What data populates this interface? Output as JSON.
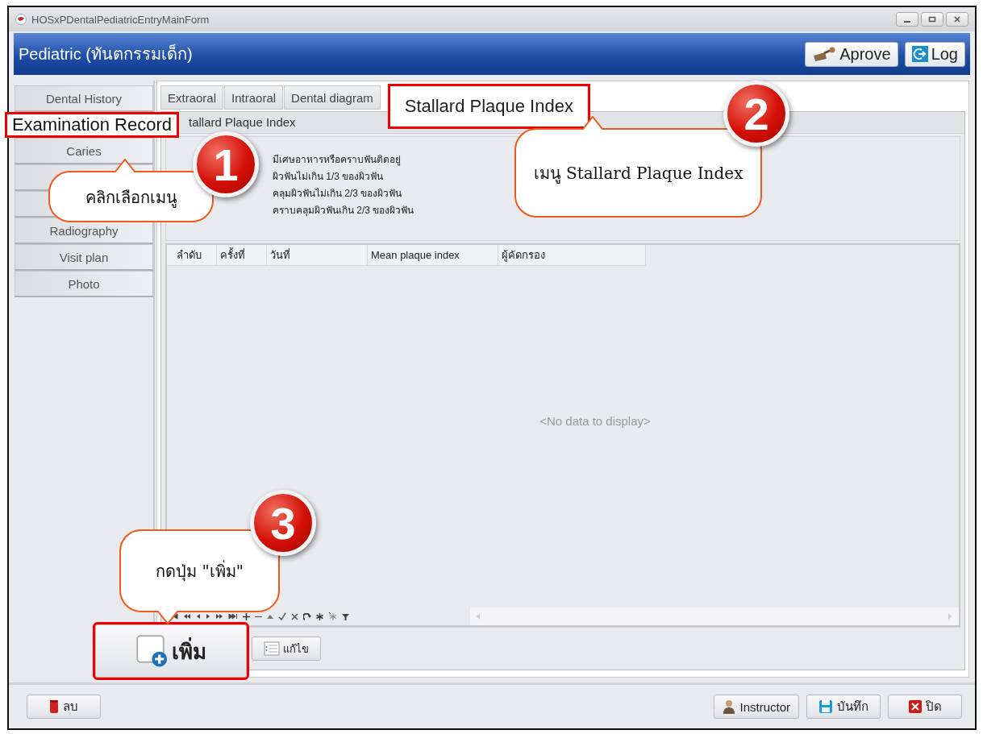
{
  "window": {
    "title": "HOSxPDentalPediatricEntryMainForm"
  },
  "header": {
    "title": "Pediatric (ทันตกรรมเด็ก)",
    "buttons": [
      {
        "label": "Aprove",
        "kind": "stamp"
      },
      {
        "label": "Log",
        "kind": "log"
      }
    ]
  },
  "sidebar": {
    "items": [
      {
        "label": "Dental History",
        "selected": false
      },
      {
        "label": "Examination Record",
        "selected": true
      },
      {
        "label": "Caries",
        "selected": false
      },
      {
        "selected": false
      },
      {
        "selected": false
      },
      {
        "label": "Radiography",
        "selected": false
      },
      {
        "label": "Visit plan",
        "selected": false
      },
      {
        "label": "Photo",
        "selected": false
      }
    ]
  },
  "tabs": [
    {
      "label": "Extraoral",
      "selected": false
    },
    {
      "label": "Intraoral",
      "selected": false
    },
    {
      "label": "Dental diagram",
      "selected": false
    },
    {
      "label": "Stallard Plaque Index",
      "selected": true
    }
  ],
  "group": {
    "title": "tallard Plaque Index",
    "legend": [
      "มีเศษอาหารหรือคราบฟันติดอยู่",
      "ผิวฟันไม่เกิน 1/3 ของผิวฟัน",
      "คลุมผิวฟันไม่เกิน 2/3 ของผิวฟัน",
      "คราบคลุมผิวฟันเกิน 2/3 ของผิวฟัน"
    ],
    "table": {
      "columns": [
        "ลำดับ",
        "ครั้งที่",
        "วันที่",
        "Mean plaque index",
        "ผู้คัดกรอง"
      ],
      "empty_text": "<No data to display>"
    },
    "buttons": [
      {
        "label": "เพิ่ม",
        "kind": "add",
        "highlighted": true
      },
      {
        "label": "แก้ไข",
        "kind": "edit",
        "highlighted": false
      }
    ]
  },
  "footer": {
    "left_buttons": [
      {
        "label": "ลบ",
        "kind": "delete"
      }
    ],
    "right_buttons": [
      {
        "label": "Instructor",
        "kind": "person"
      },
      {
        "label": "บันทึก",
        "kind": "save"
      },
      {
        "label": "ปิด",
        "kind": "close"
      }
    ]
  },
  "callouts": [
    {
      "number": "1",
      "text": "คลิกเลือกเมนู"
    },
    {
      "number": "2",
      "text": "เมนู Stallard Plaque Index"
    },
    {
      "number": "3",
      "text": "กดปุ่ม \"เพิ่ม\""
    }
  ]
}
